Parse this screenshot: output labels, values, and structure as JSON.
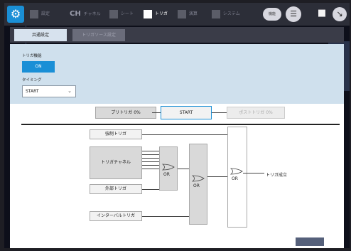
{
  "toolbar": {
    "tabs": [
      {
        "label": "設定",
        "icon": "sliders-icon",
        "active": false
      },
      {
        "label": "チャネル",
        "icon": "ch-icon",
        "active": false,
        "prefix": "CH"
      },
      {
        "label": "シート",
        "icon": "sheet-icon",
        "active": false
      },
      {
        "label": "トリガ",
        "icon": "trigger-icon",
        "active": true
      },
      {
        "label": "演算",
        "icon": "calc-icon",
        "active": false
      },
      {
        "label": "システム",
        "icon": "wrench-icon",
        "active": false
      }
    ],
    "func_label": "機能",
    "menu_icon": "list-icon",
    "folder_icon": "folder-icon",
    "arrow_icon": "arrow-icon",
    "gear_icon": "gear-icon",
    "accent_color": "#1a8fd6"
  },
  "subtabs": {
    "common": "共通設定",
    "source": "トリガソース設定"
  },
  "trigger_panel": {
    "function_label": "トリガ機能",
    "on_label": "ON",
    "timing_label": "タイミング",
    "timing_value": "START",
    "pre_trigger": "プリトリガ 0%",
    "start": "START",
    "post_trigger": "ポストトリガ 0%"
  },
  "diagram": {
    "forced_trigger": "強制トリガ",
    "trigger_channel": "トリガチャネル",
    "external_trigger": "外部トリガ",
    "interval_trigger": "インターバルトリガ",
    "or1": "OR",
    "or2": "OR",
    "or3": "OR",
    "result": "トリガ成立"
  }
}
